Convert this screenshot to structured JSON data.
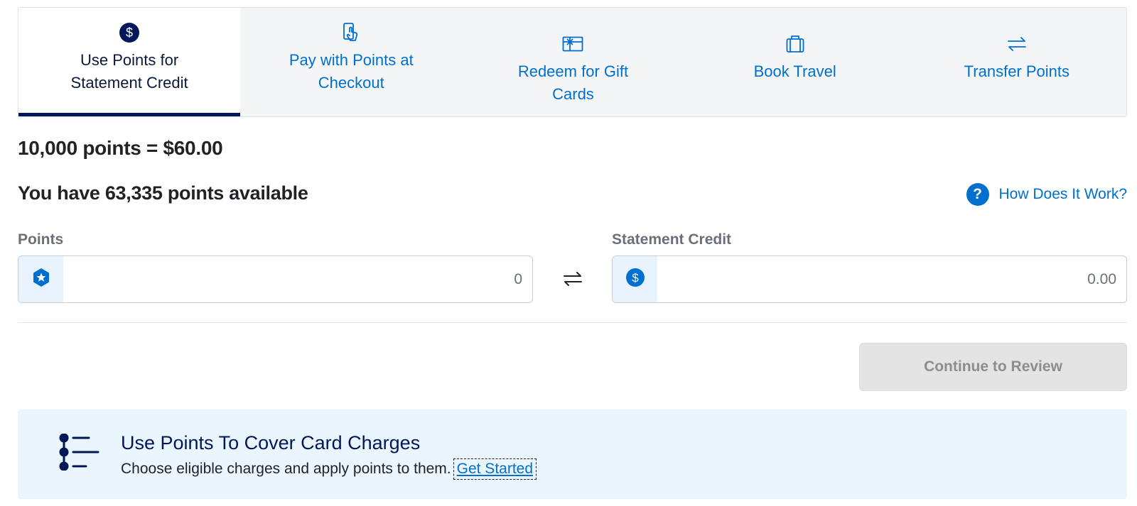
{
  "tabs": [
    {
      "label": "Use Points for Statement Credit",
      "icon": "dollar-circle-icon",
      "active": true
    },
    {
      "label": "Pay with Points at Checkout",
      "icon": "phone-tap-icon",
      "active": false
    },
    {
      "label": "Redeem for Gift Cards",
      "icon": "gift-card-icon",
      "active": false
    },
    {
      "label": "Book Travel",
      "icon": "luggage-icon",
      "active": false
    },
    {
      "label": "Transfer Points",
      "icon": "transfer-arrows-icon",
      "active": false
    }
  ],
  "summary": {
    "rate_text": "10,000 points = $60.00",
    "available_text": "You have 63,335 points available",
    "how_link": "How Does It Work?",
    "help_glyph": "?"
  },
  "points_field": {
    "label": "Points",
    "placeholder": "0",
    "icon": "star-badge-icon"
  },
  "credit_field": {
    "label": "Statement Credit",
    "placeholder": "0.00",
    "icon": "dollar-circle-icon"
  },
  "continue_button": {
    "label": "Continue to Review",
    "enabled": false
  },
  "banner": {
    "title": "Use Points To Cover Card Charges",
    "description": "Choose eligible charges and apply points to them.",
    "link": "Get Started",
    "icon": "list-steps-icon"
  },
  "colors": {
    "brand_blue": "#006fcf",
    "navy": "#00175a",
    "banner_bg": "#eaf5fd",
    "tab_bar_bg": "#f3f5f7"
  }
}
